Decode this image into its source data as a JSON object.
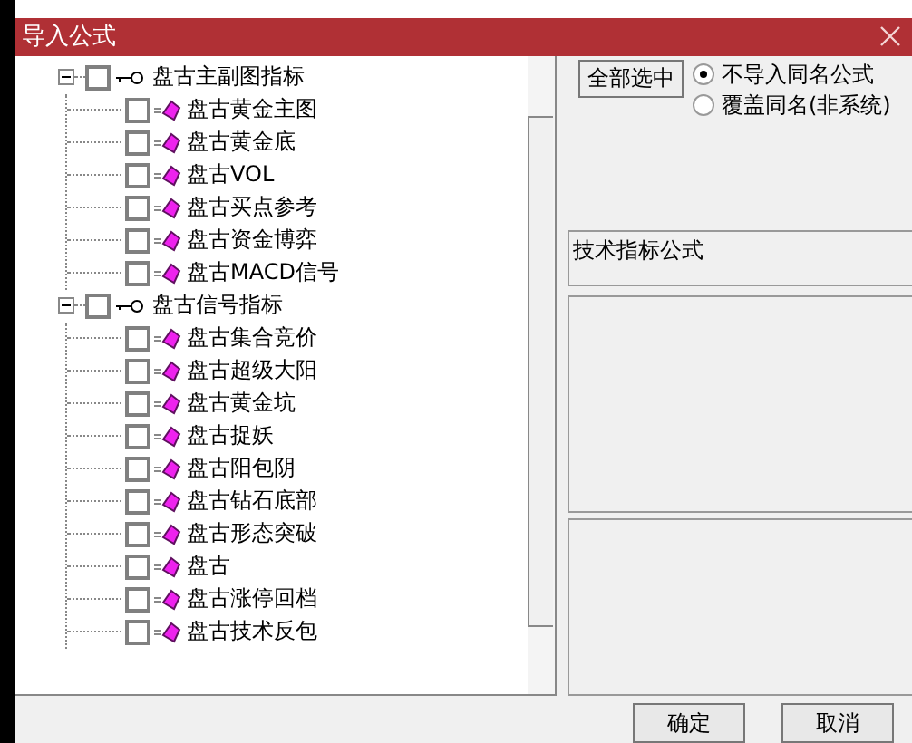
{
  "window": {
    "title": "导入公式"
  },
  "tree": [
    {
      "label": "盘古主副图指标",
      "expanded": true,
      "checked": false,
      "children": [
        {
          "label": "盘古黄金主图",
          "checked": false
        },
        {
          "label": "盘古黄金底",
          "checked": false
        },
        {
          "label": "盘古VOL",
          "checked": false
        },
        {
          "label": "盘古买点参考",
          "checked": false
        },
        {
          "label": "盘古资金博弈",
          "checked": false
        },
        {
          "label": "盘古MACD信号",
          "checked": false
        }
      ]
    },
    {
      "label": "盘古信号指标",
      "expanded": true,
      "checked": false,
      "children": [
        {
          "label": "盘古集合竞价",
          "checked": false
        },
        {
          "label": "盘古超级大阳",
          "checked": false
        },
        {
          "label": "盘古黄金坑",
          "checked": false
        },
        {
          "label": "盘古捉妖",
          "checked": false
        },
        {
          "label": "盘古阳包阴",
          "checked": false
        },
        {
          "label": "盘古钻石底部",
          "checked": false
        },
        {
          "label": "盘古形态突破",
          "checked": false
        },
        {
          "label": "盘古",
          "checked": false
        },
        {
          "label": "盘古涨停回档",
          "checked": false
        },
        {
          "label": "盘古技术反包",
          "checked": false
        }
      ]
    }
  ],
  "select_all_button": "全部选中",
  "import_options": [
    {
      "label": "不导入同名公式",
      "selected": true
    },
    {
      "label": "覆盖同名(非系统)",
      "selected": false
    }
  ],
  "formula_label": "技术指标公式",
  "footer_buttons": [
    "确定",
    "取消"
  ]
}
